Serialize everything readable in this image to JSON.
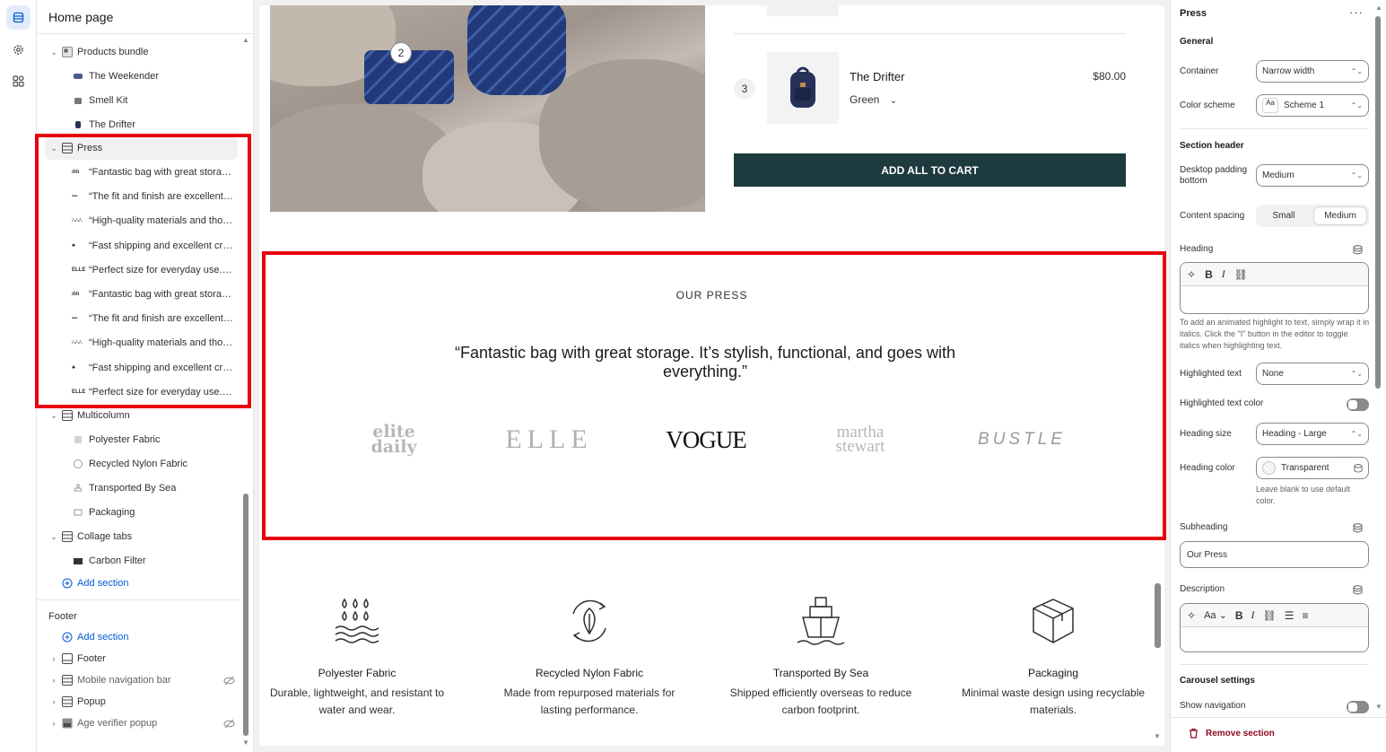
{
  "sidebar": {
    "title": "Home page",
    "products_bundle": {
      "label": "Products bundle",
      "blocks": [
        "The Weekender",
        "Smell Kit",
        "The Drifter"
      ]
    },
    "press": {
      "label": "Press",
      "blocks": [
        "“Fantastic bag with great storag…",
        "“The fit and finish are excellent.…",
        "“High-quality materials and tho…",
        "“Fast shipping and excellent cra…",
        "“Perfect size for everyday use. …",
        "“Fantastic bag with great storag…",
        "“The fit and finish are excellent.…",
        "“High-quality materials and tho…",
        "“Fast shipping and excellent cra…",
        "“Perfect size for everyday use. …"
      ]
    },
    "multicolumn": {
      "label": "Multicolumn",
      "blocks": [
        "Polyester Fabric",
        "Recycled Nylon Fabric",
        "Transported By Sea",
        "Packaging"
      ]
    },
    "collage_tabs": {
      "label": "Collage tabs",
      "blocks": [
        "Carbon Filter"
      ]
    },
    "add_section": "Add section",
    "footer_group": {
      "title": "Footer",
      "add_section": "Add section",
      "sections": [
        "Footer",
        "Mobile navigation bar",
        "Popup",
        "Age verifier popup"
      ]
    }
  },
  "preview": {
    "hotspot_number": "2",
    "bundle": {
      "item_number": "3",
      "product_name": "The Drifter",
      "price": "$80.00",
      "variant": "Green",
      "add_all_label": "ADD ALL TO CART"
    },
    "press": {
      "subheading": "OUR PRESS",
      "quote": "“Fantastic bag with great storage. It’s stylish, functional, and goes with everything.”",
      "logos": {
        "elite_daily": "elite daily",
        "elle": "ELLE",
        "vogue": "VOGUE",
        "martha_stewart": "martha stewart",
        "bustle": "BUSTLE"
      }
    },
    "features": [
      {
        "title": "Polyester Fabric",
        "desc": "Durable, lightweight, and resistant to water and wear.",
        "icon": "water-drops-icon"
      },
      {
        "title": "Recycled Nylon Fabric",
        "desc": "Made from repurposed materials for lasting performance.",
        "icon": "recycle-leaf-icon"
      },
      {
        "title": "Transported By Sea",
        "desc": "Shipped efficiently overseas to reduce carbon footprint.",
        "icon": "ship-icon"
      },
      {
        "title": "Packaging",
        "desc": "Minimal waste design using recyclable materials.",
        "icon": "box-icon"
      }
    ]
  },
  "settings": {
    "title": "Press",
    "general": "General",
    "container_label": "Container",
    "container_value": "Narrow width",
    "color_scheme_label": "Color scheme",
    "color_scheme_swatch": "Aa",
    "color_scheme_value": "Scheme 1",
    "section_header": "Section header",
    "desktop_padding_label": "Desktop padding bottom",
    "desktop_padding_value": "Medium",
    "content_spacing_label": "Content spacing",
    "content_spacing_options": [
      "Small",
      "Medium"
    ],
    "heading_label": "Heading",
    "heading_help": "To add an animated highlight to text, simply wrap it in italics. Click the \"I\" button in the editor to toggle italics when highlighting text.",
    "highlighted_text_label": "Highlighted text",
    "highlighted_text_value": "None",
    "highlighted_color_label": "Highlighted text color",
    "heading_size_label": "Heading size",
    "heading_size_value": "Heading - Large",
    "heading_color_label": "Heading color",
    "heading_color_value": "Transparent",
    "heading_color_help": "Leave blank to use default color.",
    "subheading_label": "Subheading",
    "subheading_value": "Our Press",
    "description_label": "Description",
    "description_font_btn": "Aa",
    "carousel_settings": "Carousel settings",
    "show_navigation_label": "Show navigation",
    "remove_section": "Remove section"
  },
  "colors": {
    "highlight_border": "#e8000f",
    "cart_button": "#1d3a3e",
    "link": "#005bd3",
    "remove": "#8e0b21"
  }
}
